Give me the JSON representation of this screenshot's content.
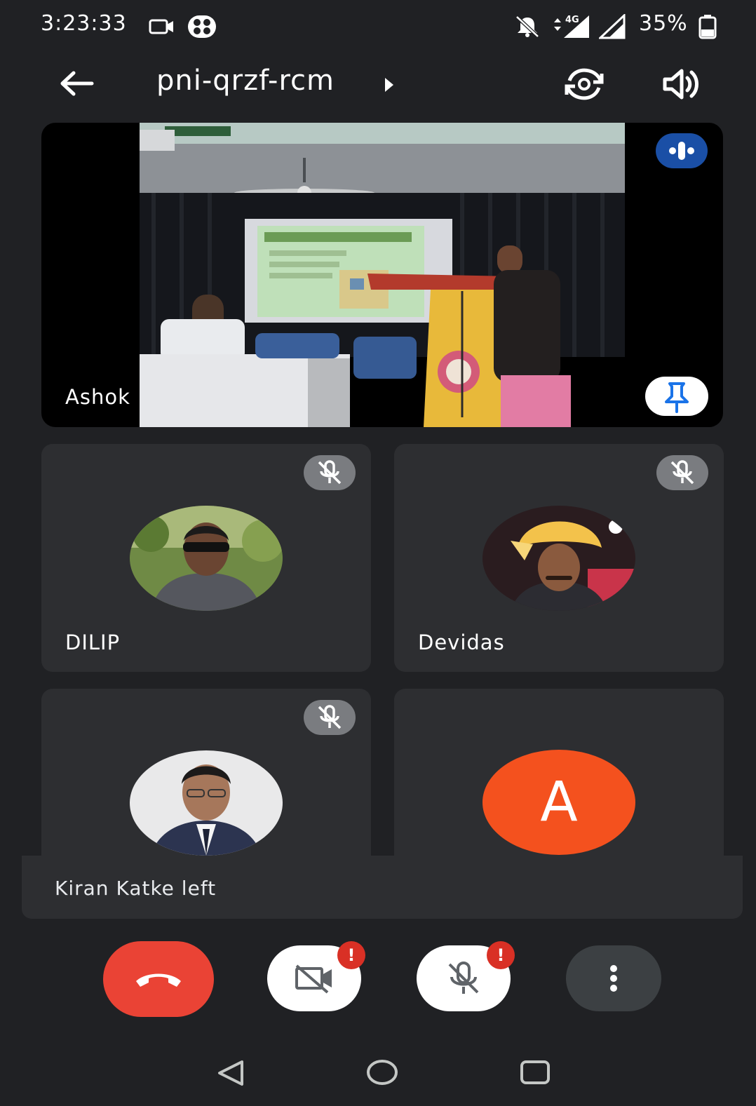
{
  "status_bar": {
    "time": "3:23:33",
    "network": "4G",
    "battery": "35%"
  },
  "app_bar": {
    "meeting_code": "pni-qrzf-rcm"
  },
  "main_tile": {
    "participant_name": "Ashok"
  },
  "tiles": [
    {
      "name": "DILIP",
      "muted": true
    },
    {
      "name": "Devidas",
      "muted": true
    },
    {
      "name": "",
      "muted": true
    },
    {
      "name": "",
      "avatar_letter": "A"
    }
  ],
  "toast": {
    "message": "Kiran Katke left"
  },
  "controls": {
    "camera_alert": "!",
    "mic_alert": "!"
  },
  "colors": {
    "background": "#202124",
    "tile": "#2d2e31",
    "end_call": "#ea4335",
    "avatar_orange": "#f4511e",
    "speaker_pill": "#1a4fa6",
    "alert": "#d93025"
  }
}
